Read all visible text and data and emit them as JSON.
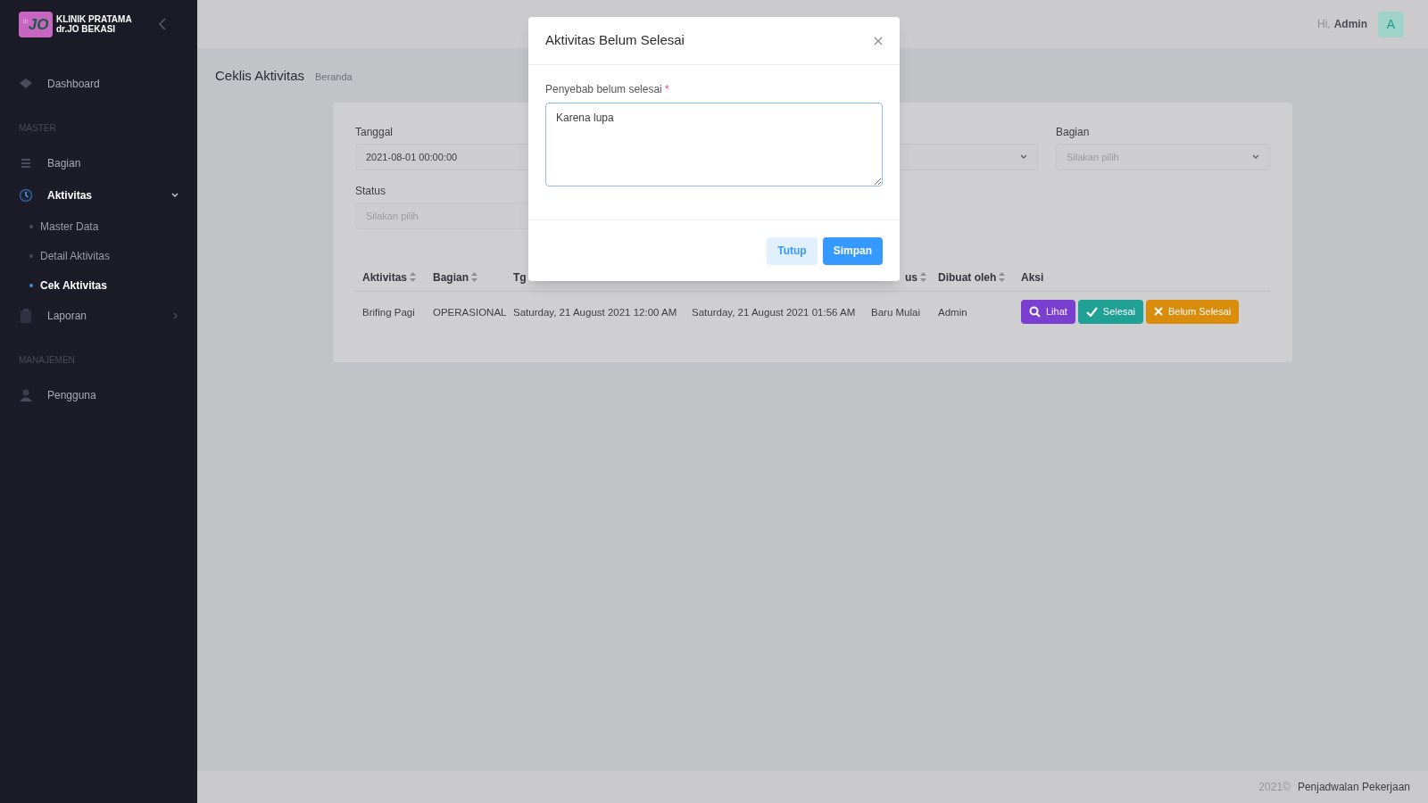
{
  "sidebar": {
    "logo": {
      "prefix": "dr",
      "text": "JO"
    },
    "brand": [
      "KLINIK PRATAMA",
      "dr.JO BEKASI"
    ],
    "items": [
      {
        "kind": "link",
        "label": "Dashboard",
        "selected": false
      },
      {
        "kind": "section",
        "label": "MASTER"
      },
      {
        "kind": "link",
        "label": "Bagian",
        "selected": false
      },
      {
        "kind": "group",
        "label": "Aktivitas",
        "selected": true,
        "expanded": true,
        "children": [
          {
            "label": "Master Data",
            "selected": false
          },
          {
            "label": "Detail Aktivitas",
            "selected": false
          },
          {
            "label": "Cek Aktivitas",
            "selected": true
          }
        ]
      },
      {
        "kind": "group",
        "label": "Laporan",
        "selected": false,
        "expanded": false
      },
      {
        "kind": "section",
        "label": "MANAJEMEN"
      },
      {
        "kind": "link",
        "label": "Pengguna",
        "selected": false
      }
    ]
  },
  "header": {
    "greeting": "Hi,",
    "user": "Admin",
    "avatar": "A"
  },
  "page": {
    "title": "Ceklis Aktivitas",
    "breadcrumb": "Beranda"
  },
  "filters": [
    {
      "kind": "input",
      "label": "Tanggal",
      "value": "2021-08-01 00:00:00"
    },
    {
      "kind": "select"
    },
    {
      "kind": "select",
      "label": "Bagian",
      "placeholder": "Silakan pilih"
    },
    {
      "kind": "input",
      "label": "Status",
      "placeholder": "Silakan pilih"
    }
  ],
  "table": {
    "columns": [
      {
        "label": "Aktivitas",
        "sortable": true
      },
      {
        "label": "Bagian",
        "sortable": true
      },
      {
        "label": "Tg",
        "sortable": false
      },
      {},
      {
        "label": "us",
        "sortable": true
      },
      {
        "label": "Dibuat oleh",
        "sortable": true
      },
      {
        "label": "Aksi",
        "sortable": false
      }
    ],
    "rows": [
      {
        "cells": [
          "Brifing Pagi",
          "OPERASIONAL",
          "Saturday, 21 August 2021 12:00 AM",
          "Saturday, 21 August 2021 01:56 AM",
          "Baru Mulai",
          "Admin"
        ],
        "actions": [
          {
            "kind": "view",
            "label": "Lihat"
          },
          {
            "kind": "done",
            "label": "Selesai"
          },
          {
            "kind": "undone",
            "label": "Belum Selesai"
          }
        ]
      }
    ]
  },
  "modal": {
    "title": "Aktivitas Belum Selesai",
    "label": "Penyebab belum selesai",
    "required_mark": "*",
    "value": "Karena lupa",
    "buttons": [
      {
        "kind": "secondary",
        "label": "Tutup"
      },
      {
        "kind": "primary",
        "label": "Simpan"
      }
    ]
  },
  "footer": {
    "year": "2021©",
    "text": "Penjadwalan Pekerjaan"
  }
}
